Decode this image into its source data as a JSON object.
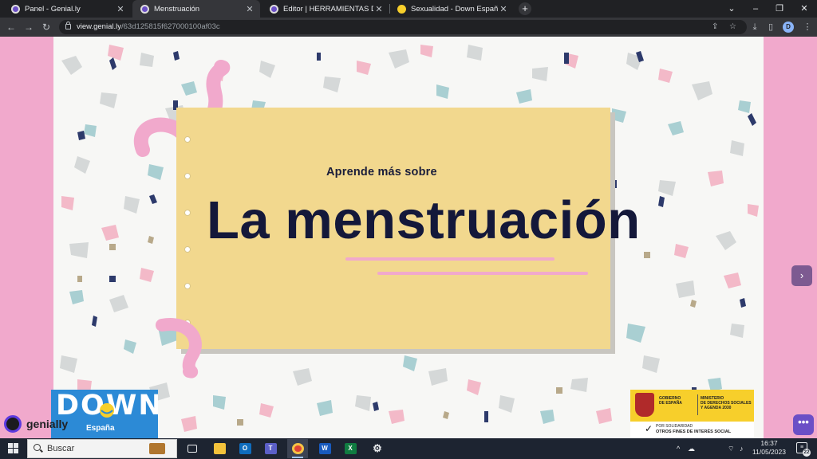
{
  "browser": {
    "tabs": [
      {
        "label": "Panel - Genial.ly",
        "favicon_color": "#6b4fc6",
        "active": false
      },
      {
        "label": "Menstruación",
        "favicon_color": "#6b4fc6",
        "active": true
      },
      {
        "label": "Editor | HERRAMIENTAS DIGITALES",
        "favicon_color": "#6b4fc6",
        "active": false
      },
      {
        "label": "Sexualidad - Down España",
        "favicon_color": "#f7cf2b",
        "active": false
      }
    ],
    "new_tab": "+",
    "window_controls": {
      "tab_search": "⌄",
      "minimize": "–",
      "restore": "❐",
      "close": "✕"
    },
    "nav": {
      "back": "←",
      "forward": "→",
      "reload": "↻"
    },
    "url_host": "view.genial.ly",
    "url_path": "/63d125815f627000100af03c",
    "profile_initial": "D",
    "toolbar_icons": {
      "share": "⇪",
      "bookmark": "☆",
      "download": "⤓",
      "sidepanel": "▯",
      "menu": "⋮"
    }
  },
  "slide": {
    "subtitle": "Aprende más sobre",
    "title": "La menstruación",
    "next_button": "›",
    "more_button": "•••"
  },
  "logos": {
    "down_word": "DOWN",
    "down_sub": "España",
    "genially": "genially",
    "gov_left": [
      "GOBIERNO",
      "DE ESPAÑA"
    ],
    "gov_right": [
      "MINISTERIO",
      "DE DERECHOS SOCIALES",
      "Y AGENDA 2030"
    ],
    "gov_sol_small": "POR SOLIDARIDAD",
    "gov_sol_big": "OTROS FINES DE INTERÉS SOCIAL"
  },
  "taskbar": {
    "search_placeholder": "Buscar",
    "time": "16:37",
    "date": "11/05/2023",
    "notifications_count": "22",
    "tray_arrow": "^"
  },
  "colors": {
    "background_pink": "#f1a9cc",
    "card_yellow": "#f2d88e",
    "title_navy": "#14183a",
    "down_blue": "#2c8ad6",
    "gov_yellow": "#f7cf2b"
  }
}
